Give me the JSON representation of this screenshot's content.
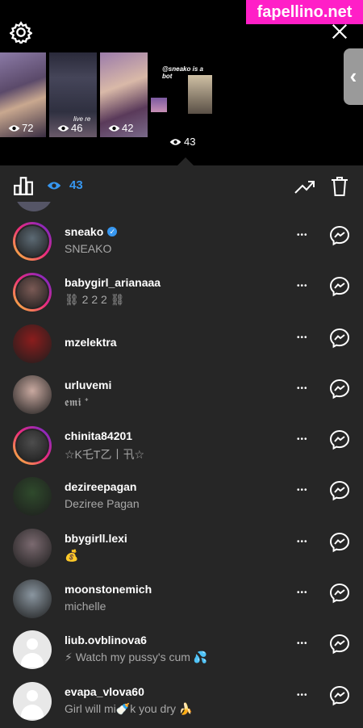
{
  "watermark": "fapellino.net",
  "stories": [
    {
      "views": "72"
    },
    {
      "views": "46"
    },
    {
      "views": "42"
    },
    {
      "caption": "@sneako is a bot",
      "views": "43"
    }
  ],
  "story_caption_t2": "live re",
  "toolbar": {
    "views": "43"
  },
  "viewers": [
    {
      "username": "sneako",
      "subtitle": "SNEAKO",
      "verified": true,
      "ring": true,
      "avatar": "#5c6a74"
    },
    {
      "username": "babygirl_arianaaa",
      "subtitle": "⛓ 2 2 2 ⛓",
      "verified": false,
      "ring": true,
      "avatar": "#7a5a55"
    },
    {
      "username": "mzelektra",
      "subtitle": "",
      "verified": false,
      "ring": false,
      "avatar": "#8b1d1d"
    },
    {
      "username": "urluvemi",
      "subtitle": "𝖊𝖒𝖎 ᐩ",
      "verified": false,
      "ring": false,
      "avatar": "#c9a9a0"
    },
    {
      "username": "chinita84201",
      "subtitle": "☆K乇T乙丨卂☆",
      "verified": false,
      "ring": true,
      "avatar": "#4d4d4d"
    },
    {
      "username": "dezireepagan",
      "subtitle": "Deziree Pagan",
      "verified": false,
      "ring": false,
      "avatar": "#2f4a2c"
    },
    {
      "username": "bbygirll.lexi",
      "subtitle": "💰",
      "verified": false,
      "ring": false,
      "avatar": "#7b6a70"
    },
    {
      "username": "moonstonemich",
      "subtitle": "michelle",
      "verified": false,
      "ring": false,
      "avatar": "#8a96a0"
    },
    {
      "username": "liub.ovblinova6",
      "subtitle": "⚡ Watch my pussy's cum 💦",
      "verified": false,
      "ring": false,
      "avatar": "blank"
    },
    {
      "username": "evapa_vlova60",
      "subtitle": "Girl will mi🍼k you dry 🍌",
      "verified": false,
      "ring": false,
      "avatar": "blank"
    }
  ],
  "icons": {
    "settings": "gear-icon",
    "close": "close-icon",
    "insights": "bar-chart-icon",
    "views": "eye-icon",
    "trend": "trend-icon",
    "delete": "trash-icon",
    "more": "more-icon",
    "message": "messenger-icon"
  },
  "colors": {
    "accent": "#3797f0",
    "panel": "#262626",
    "watermark": "#ff1fc7"
  }
}
